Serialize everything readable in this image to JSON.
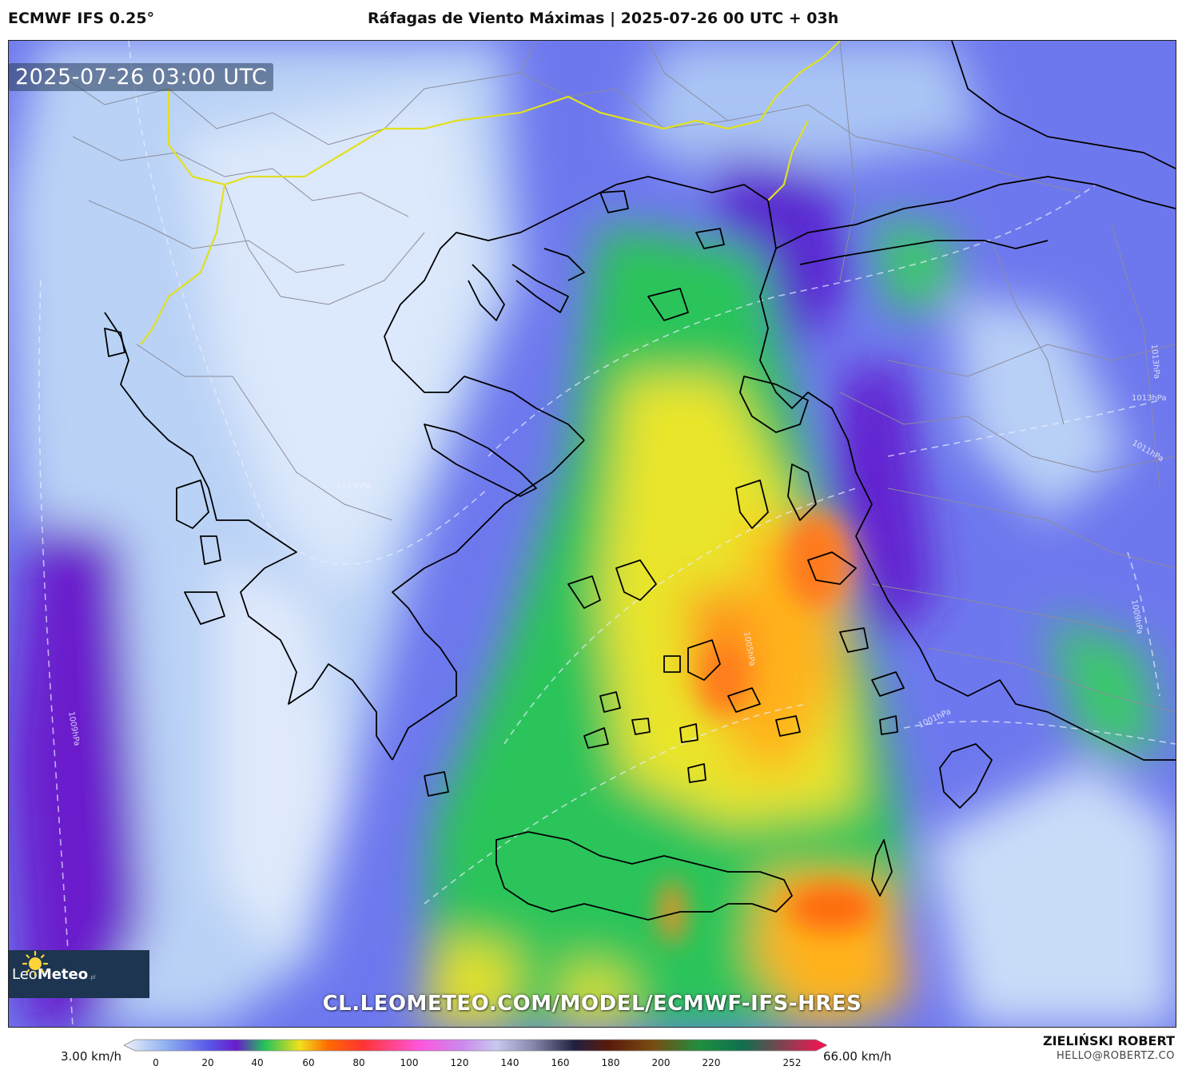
{
  "header": {
    "model": "ECMWF IFS 0.25°",
    "title": "Ráfagas de Viento Máximas | 2025-07-26 00 UTC + 03h"
  },
  "map": {
    "timestamp": "2025-07-26 03:00 UTC",
    "watermark": "CL.LEOMETEO.COM/MODEL/ECMWF-IFS-HRES",
    "isobar_labels": [
      "1013hPa",
      "1013hPa",
      "1011hPa",
      "1009hPa",
      "1005hPa",
      "1001hPa",
      "1009hPa",
      "1013hPa"
    ]
  },
  "logo": {
    "name_light": "Leo",
    "name_bold": "Meteo",
    "tld": ".pl"
  },
  "legend": {
    "min_label": "3.00 km/h",
    "max_label": "66.00 km/h",
    "ticks": [
      "0",
      "20",
      "40",
      "60",
      "80",
      "100",
      "120",
      "140",
      "160",
      "180",
      "200",
      "220",
      "252"
    ],
    "colors": [
      "#e8eef8",
      "#8fb0f0",
      "#5858e8",
      "#6a1ccc",
      "#22c35a",
      "#f2e01c",
      "#ff6a00",
      "#ff3333",
      "#ff55dd",
      "#cc88ee",
      "#c8c8f0",
      "#8a8ab0",
      "#202040",
      "#5a1a0a",
      "#7a4a10",
      "#1f8f3f",
      "#0f6f4f",
      "#ff1050"
    ]
  },
  "credits": {
    "name": "ZIELIŃSKI ROBERT",
    "email": "HELLO@ROBERTZ.CO"
  }
}
